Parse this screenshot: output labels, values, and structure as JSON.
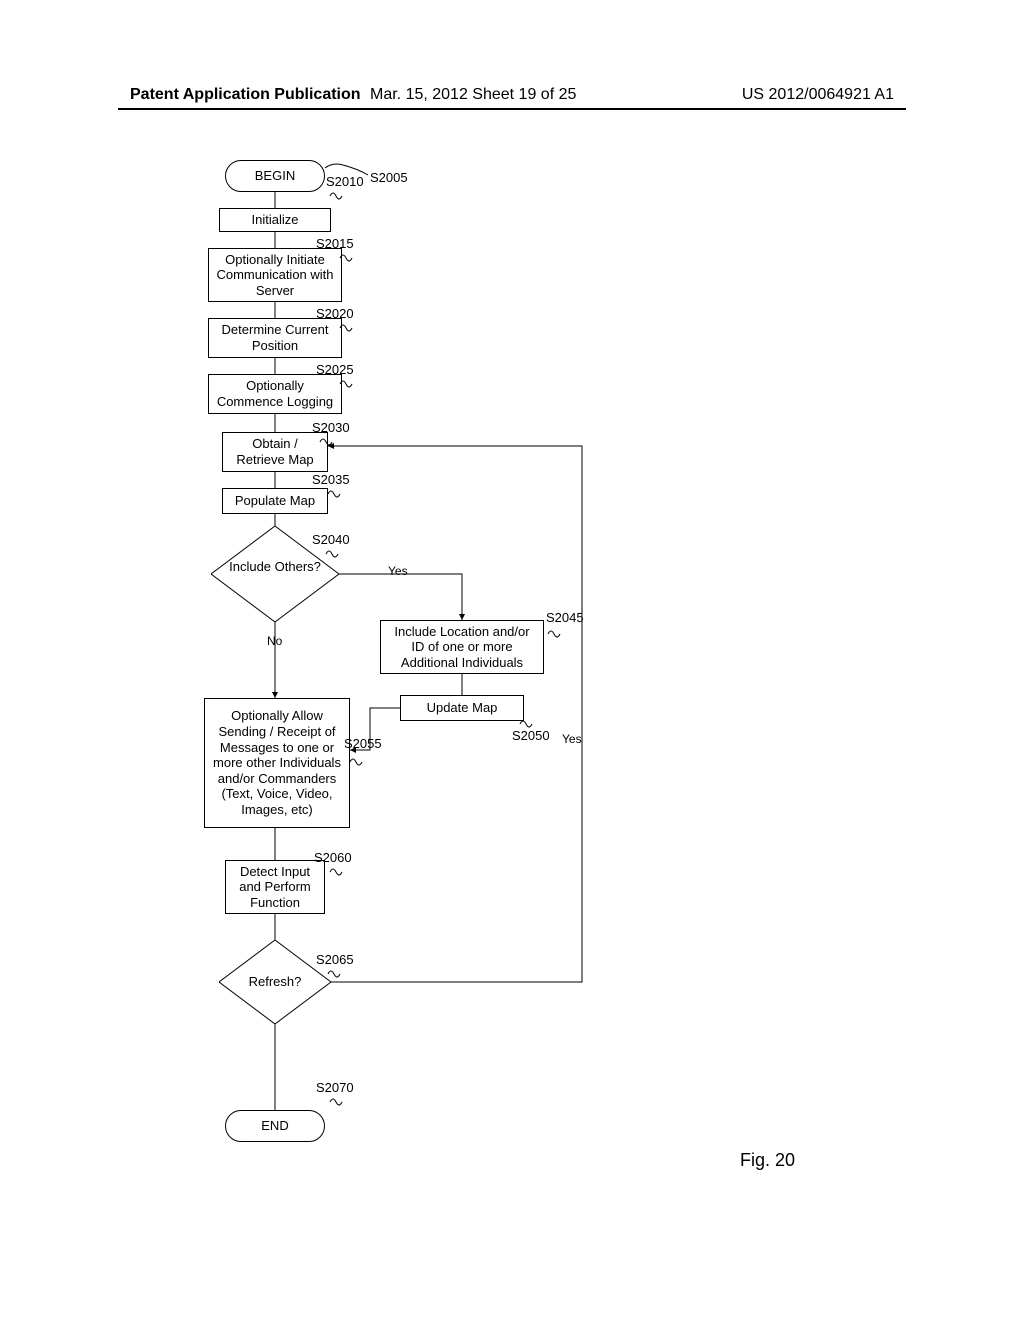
{
  "header": {
    "left": "Patent Application Publication",
    "center": "Mar. 15, 2012  Sheet 19 of 25",
    "right": "US 2012/0064921 A1"
  },
  "flow": {
    "begin": "BEGIN",
    "end": "END",
    "s2010": "Initialize",
    "s2015": "Optionally Initiate Communication with Server",
    "s2020": "Determine Current Position",
    "s2025": "Optionally Commence Logging",
    "s2030": "Obtain / Retrieve Map",
    "s2035": "Populate Map",
    "s2040": "Include Others?",
    "s2045": "Include Location and/or ID of one or more Additional Individuals",
    "s2050": "Update Map",
    "s2055": "Optionally Allow Sending / Receipt of Messages to one or more other Individuals and/or Commanders (Text, Voice, Video, Images, etc)",
    "s2060": "Detect Input and Perform Function",
    "s2065": "Refresh?"
  },
  "refs": {
    "s2005": "S2005",
    "s2010": "S2010",
    "s2015": "S2015",
    "s2020": "S2020",
    "s2025": "S2025",
    "s2030": "S2030",
    "s2035": "S2035",
    "s2040": "S2040",
    "s2045": "S2045",
    "s2050": "S2050",
    "s2055": "S2055",
    "s2060": "S2060",
    "s2065": "S2065",
    "s2070": "S2070"
  },
  "labels": {
    "yes": "Yes",
    "no": "No"
  },
  "figure": "Fig. 20"
}
